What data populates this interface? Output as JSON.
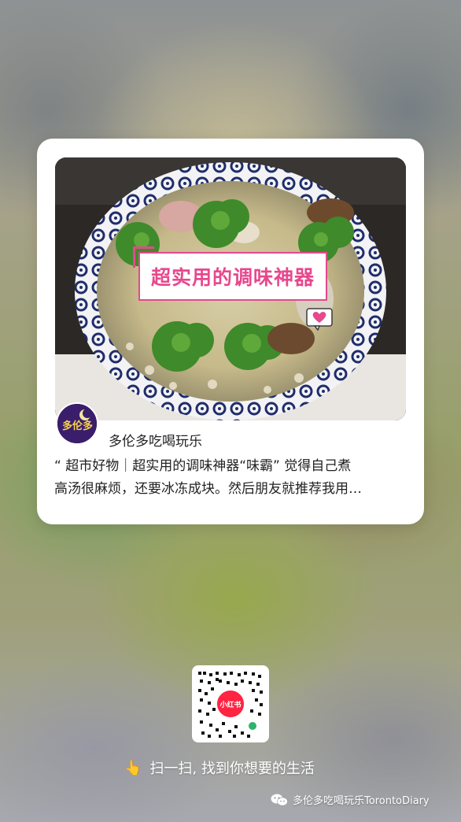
{
  "card": {
    "image_overlay_title": "超实用的调味神器",
    "author_name": "多伦多吃喝玩乐",
    "description_line1": "“ 超市好物｜超实用的调味神器“味霸” 觉得自己煮",
    "description_line2": "高汤很麻烦，还要冰冻成块。然后朋友就推荐我用…",
    "avatar_text": "多伦多"
  },
  "qr": {
    "logo_text": "小红书"
  },
  "scan": {
    "label": "扫一扫, 找到你想要的生活"
  },
  "footer": {
    "account_label": "多伦多吃喝玩乐TorontoDiary"
  },
  "icons": {
    "hand": "pointing-hand-icon",
    "heart": "heart-bubble-icon",
    "wechat": "wechat-icon"
  },
  "colors": {
    "accent_pink": "#e8488d",
    "brand_red": "#ff2442"
  }
}
